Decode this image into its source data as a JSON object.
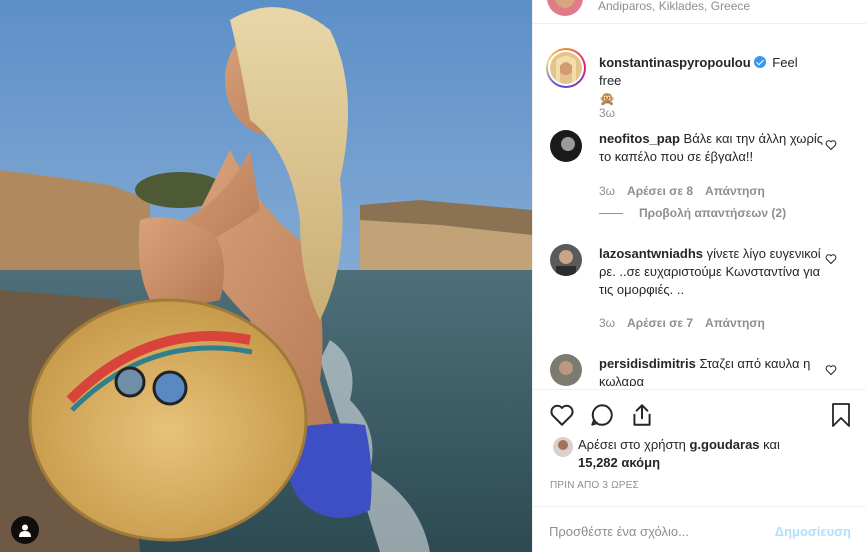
{
  "location": {
    "text": "Andiparos, Kiklades, Greece"
  },
  "caption": {
    "username": "konstantinaspyropoulou",
    "text": "Feel free",
    "emoji": "🙊",
    "time": "3ω"
  },
  "comments": [
    {
      "username": "neofitos_pap",
      "text": "Βάλε και την άλλη χωρίς το καπέλο που σε έβγαλα!!",
      "time": "3ω",
      "likes": "Αρέσει σε 8",
      "reply": "Απάντηση",
      "view_replies": "Προβολή απαντήσεων (2)"
    },
    {
      "username": "lazosantwniadhs",
      "text": "γίνετε λίγο ευγενικοί ρε. ..σε ευχαριστούμε Κωνσταντίνα για τις ομορφιές. ..",
      "time": "3ω",
      "likes": "Αρέσει σε 7",
      "reply": "Απάντηση"
    },
    {
      "username": "persidisdimitris",
      "text": "Σταζει από καυλα η κωλαρα"
    }
  ],
  "likes": {
    "prefix": "Αρέσει στο χρήστη",
    "user": "g.goudaras",
    "and": "και",
    "count": "15,282 ακόμη"
  },
  "time_ago": "ΠΡΙΝ ΑΠΟ 3 ΩΡΕΣ",
  "add_comment": {
    "placeholder": "Προσθέστε ένα σχόλιο...",
    "post_label": "Δημοσίευση"
  },
  "icons": [
    "user-tag-icon",
    "heart-icon",
    "comment-icon",
    "share-icon",
    "bookmark-icon",
    "verified-badge-icon"
  ]
}
